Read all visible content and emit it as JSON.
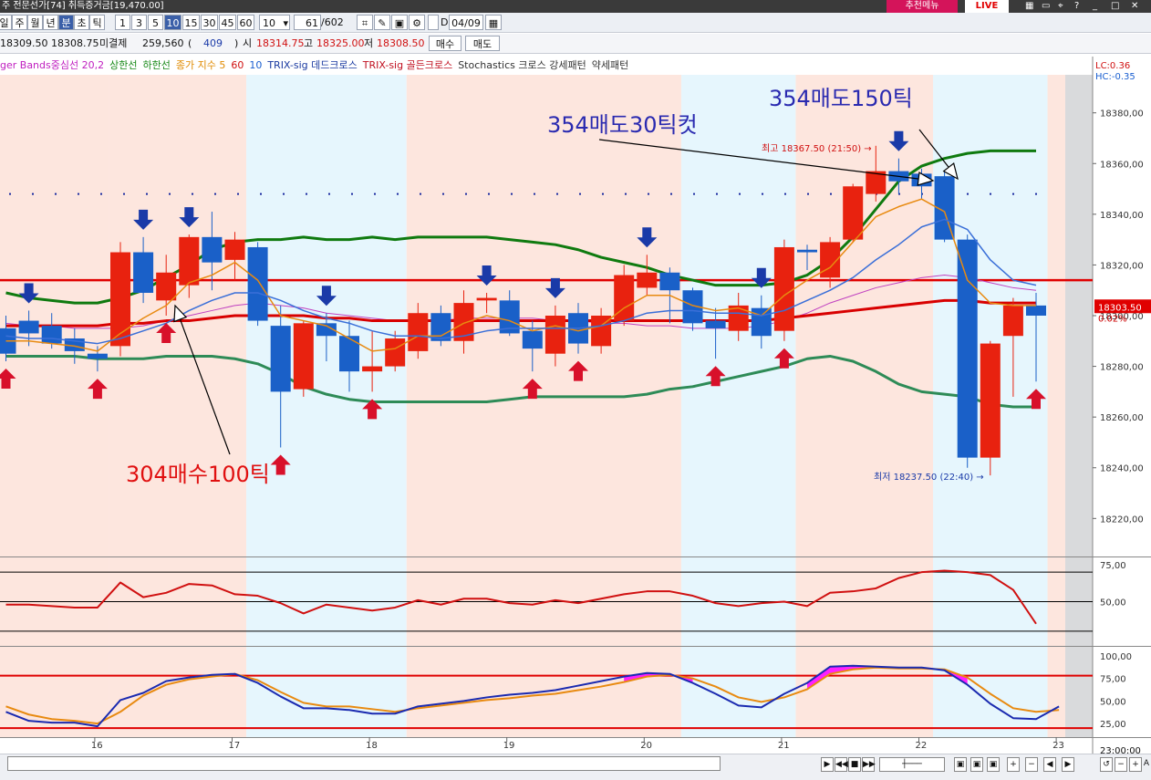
{
  "topbar": {
    "title_fragment": "주 전문선가[74] 취득증거금[19,470.00]",
    "btn_recommend": "추천메뉴",
    "btn_live": "LIVE",
    "icons": [
      "grid-icon",
      "window-icon",
      "pin-icon",
      "help-icon",
      "minimize-icon",
      "maximize-icon",
      "close-icon"
    ]
  },
  "toolbar": {
    "periods": [
      "일",
      "주",
      "월",
      "년",
      "분",
      "초",
      "틱"
    ],
    "selected_period": "분",
    "intervals": [
      "1",
      "3",
      "5",
      "10",
      "15",
      "30",
      "45",
      "60"
    ],
    "selected_interval": "10",
    "interval_input": "10",
    "count_value": "61",
    "count_total": "/602",
    "date_value": "04/09",
    "date_prefix": "D"
  },
  "quote": {
    "current": "18309.50",
    "prev": "18308.75",
    "open_interest_label": "미결제",
    "open_interest": "259,560",
    "paren_open": "(",
    "oi_change": "409",
    "paren_close": ")",
    "open_label": "시",
    "open": "18314.75",
    "high_label": "고",
    "high": "18325.00",
    "low_label": "저",
    "low": "18308.50",
    "buy_label": "매수",
    "sell_label": "매도"
  },
  "legend": [
    {
      "text": "ger Bands중심선 20,2",
      "color": "#c020c0"
    },
    {
      "text": "상한선",
      "color": "#1a8a1a"
    },
    {
      "text": "하한선",
      "color": "#1a8a1a"
    },
    {
      "text": "종가 지수 5",
      "color": "#e08a00"
    },
    {
      "text": "60",
      "color": "#d01010"
    },
    {
      "text": "10",
      "color": "#1a5fd0"
    },
    {
      "text": "TRIX-sig 데드크로스",
      "color": "#1a3aa0"
    },
    {
      "text": "TRIX-sig 골든크로스",
      "color": "#c01020"
    },
    {
      "text": "Stochastics 크로스 강세패턴",
      "color": "#333333"
    },
    {
      "text": "약세패턴",
      "color": "#333333"
    }
  ],
  "right_readout": {
    "lc": "LC:0.36",
    "hc": "HC:-0.35",
    "last_price": "18303.50",
    "last_change": "0.02%"
  },
  "annotations": {
    "buy_note": "304매수100틱",
    "sell_note_1": "354매도150틱",
    "sell_note_2": "354매도30틱컷",
    "high_marker": "최고 18367.50 (21:50) →",
    "low_marker": "최저 18237.50 (22:40) →"
  },
  "bottombar": {
    "time_label": "23:00:00"
  },
  "colors": {
    "up": "#e8220f",
    "down": "#1a60c8",
    "upper_band": "#0f7a0f",
    "lower_band": "#2e8b57",
    "ema5": "#e88a10",
    "ma10": "#3a6fd8",
    "mid_band": "#c040c0",
    "ma60": "#d80000",
    "buy_arrow": "#d8102a",
    "sell_arrow": "#1a3aa8",
    "session_pink": "#fde6de",
    "session_blue": "#e6f6fd"
  },
  "chart_data": {
    "type": "candlestick",
    "price_axis": {
      "ticks": [
        18220,
        18240,
        18260,
        18280,
        18300,
        18320,
        18340,
        18360,
        18380
      ],
      "tick_labels": [
        "18220,00",
        "18240,00",
        "18260,00",
        "18280,00",
        "18300,00",
        "18320,00",
        "18340,00",
        "18360,00",
        "18380,00"
      ],
      "range": [
        18205,
        18395
      ]
    },
    "time_axis": {
      "labels": [
        "16",
        "17",
        "18",
        "19",
        "20",
        "21",
        "22",
        "23"
      ],
      "label_bar_index": [
        4,
        10,
        16,
        22,
        28,
        34,
        40,
        46
      ]
    },
    "sessions": [
      {
        "from": -1,
        "to": 4,
        "shade": "pink"
      },
      {
        "from": 4,
        "to": 10,
        "shade": "pink"
      },
      {
        "from": 10,
        "to": 17,
        "shade": "blue"
      },
      {
        "from": 17,
        "to": 29,
        "shade": "pink"
      },
      {
        "from": 29,
        "to": 34,
        "shade": "blue"
      },
      {
        "from": 34,
        "to": 40,
        "shade": "pink"
      },
      {
        "from": 40,
        "to": 45,
        "shade": "blue"
      },
      {
        "from": 45,
        "to": 47,
        "shade": "pink"
      }
    ],
    "candles": [
      {
        "o": 18295,
        "h": 18300,
        "l": 18282,
        "c": 18285
      },
      {
        "o": 18298,
        "h": 18302,
        "l": 18288,
        "c": 18293
      },
      {
        "o": 18296,
        "h": 18301,
        "l": 18287,
        "c": 18289
      },
      {
        "o": 18291,
        "h": 18295,
        "l": 18281,
        "c": 18286
      },
      {
        "o": 18285,
        "h": 18288,
        "l": 18278,
        "c": 18283
      },
      {
        "o": 18288,
        "h": 18329,
        "l": 18284,
        "c": 18325
      },
      {
        "o": 18325,
        "h": 18331,
        "l": 18305,
        "c": 18309
      },
      {
        "o": 18306,
        "h": 18324,
        "l": 18300,
        "c": 18317
      },
      {
        "o": 18312,
        "h": 18332,
        "l": 18307,
        "c": 18331
      },
      {
        "o": 18331,
        "h": 18341,
        "l": 18310,
        "c": 18321
      },
      {
        "o": 18322,
        "h": 18333,
        "l": 18314,
        "c": 18330
      },
      {
        "o": 18327,
        "h": 18329,
        "l": 18296,
        "c": 18298
      },
      {
        "o": 18296,
        "h": 18304,
        "l": 18248,
        "c": 18270
      },
      {
        "o": 18271,
        "h": 18298,
        "l": 18268,
        "c": 18297
      },
      {
        "o": 18297,
        "h": 18301,
        "l": 18282,
        "c": 18292
      },
      {
        "o": 18292,
        "h": 18298,
        "l": 18270,
        "c": 18278
      },
      {
        "o": 18278,
        "h": 18294,
        "l": 18270,
        "c": 18280
      },
      {
        "o": 18280,
        "h": 18294,
        "l": 18278,
        "c": 18291
      },
      {
        "o": 18286,
        "h": 18305,
        "l": 18283,
        "c": 18301
      },
      {
        "o": 18301,
        "h": 18304,
        "l": 18288,
        "c": 18290
      },
      {
        "o": 18290,
        "h": 18310,
        "l": 18285,
        "c": 18305
      },
      {
        "o": 18306,
        "h": 18309,
        "l": 18301,
        "c": 18307
      },
      {
        "o": 18306,
        "h": 18310,
        "l": 18292,
        "c": 18293
      },
      {
        "o": 18294,
        "h": 18298,
        "l": 18278,
        "c": 18287
      },
      {
        "o": 18285,
        "h": 18304,
        "l": 18280,
        "c": 18300
      },
      {
        "o": 18301,
        "h": 18305,
        "l": 18285,
        "c": 18289
      },
      {
        "o": 18288,
        "h": 18303,
        "l": 18285,
        "c": 18300
      },
      {
        "o": 18298,
        "h": 18320,
        "l": 18296,
        "c": 18316
      },
      {
        "o": 18311,
        "h": 18324,
        "l": 18308,
        "c": 18317
      },
      {
        "o": 18317,
        "h": 18319,
        "l": 18297,
        "c": 18310
      },
      {
        "o": 18310,
        "h": 18311,
        "l": 18294,
        "c": 18297
      },
      {
        "o": 18298,
        "h": 18303,
        "l": 18283,
        "c": 18295
      },
      {
        "o": 18294,
        "h": 18309,
        "l": 18290,
        "c": 18304
      },
      {
        "o": 18303,
        "h": 18308,
        "l": 18287,
        "c": 18292
      },
      {
        "o": 18294,
        "h": 18330,
        "l": 18290,
        "c": 18327
      },
      {
        "o": 18326,
        "h": 18328,
        "l": 18318,
        "c": 18325
      },
      {
        "o": 18315,
        "h": 18331,
        "l": 18311,
        "c": 18329
      },
      {
        "o": 18330,
        "h": 18352,
        "l": 18329,
        "c": 18351
      },
      {
        "o": 18348,
        "h": 18367,
        "l": 18345,
        "c": 18357
      },
      {
        "o": 18357,
        "h": 18362,
        "l": 18348,
        "c": 18353
      },
      {
        "o": 18356,
        "h": 18358,
        "l": 18346,
        "c": 18351
      },
      {
        "o": 18355,
        "h": 18357,
        "l": 18329,
        "c": 18330
      },
      {
        "o": 18330,
        "h": 18332,
        "l": 18240,
        "c": 18244
      },
      {
        "o": 18244,
        "h": 18290,
        "l": 18237,
        "c": 18289
      },
      {
        "o": 18292,
        "h": 18307,
        "l": 18268,
        "c": 18304
      },
      {
        "o": 18304,
        "h": 18309,
        "l": 18274,
        "c": 18300
      }
    ],
    "series": [
      {
        "name": "상한선",
        "values": [
          18309,
          18307,
          18306,
          18305,
          18305,
          18307,
          18310,
          18315,
          18320,
          18326,
          18329,
          18330,
          18330,
          18331,
          18330,
          18330,
          18331,
          18330,
          18331,
          18331,
          18331,
          18331,
          18330,
          18329,
          18328,
          18326,
          18323,
          18321,
          18319,
          18316,
          18314,
          18312,
          18312,
          18312,
          18313,
          18316,
          18322,
          18331,
          18342,
          18353,
          18359,
          18362,
          18364,
          18365,
          18365,
          18365
        ]
      },
      {
        "name": "하한선",
        "values": [
          18284,
          18284,
          18284,
          18284,
          18283,
          18283,
          18283,
          18284,
          18284,
          18284,
          18283,
          18281,
          18277,
          18272,
          18269,
          18267,
          18266,
          18266,
          18266,
          18266,
          18266,
          18266,
          18267,
          18268,
          18268,
          18268,
          18268,
          18268,
          18269,
          18271,
          18272,
          18274,
          18276,
          18278,
          18280,
          18283,
          18284,
          18282,
          18278,
          18273,
          18270,
          18269,
          18268,
          18265,
          18264,
          18264
        ]
      },
      {
        "name": "종가 지수 5",
        "values": [
          18290,
          18290,
          18289,
          18288,
          18286,
          18293,
          18299,
          18304,
          18313,
          18316,
          18321,
          18314,
          18300,
          18298,
          18296,
          18291,
          18286,
          18287,
          18292,
          18292,
          18297,
          18300,
          18298,
          18294,
          18296,
          18294,
          18296,
          18303,
          18308,
          18308,
          18304,
          18302,
          18303,
          18300,
          18308,
          18314,
          18319,
          18329,
          18339,
          18343,
          18346,
          18341,
          18314,
          18305,
          18304,
          18304
        ]
      },
      {
        "name": "10",
        "values": [
          18292,
          18291,
          18291,
          18290,
          18289,
          18291,
          18294,
          18297,
          18302,
          18306,
          18309,
          18309,
          18306,
          18302,
          18299,
          18297,
          18294,
          18292,
          18292,
          18291,
          18292,
          18294,
          18295,
          18295,
          18295,
          18295,
          18296,
          18298,
          18301,
          18302,
          18302,
          18301,
          18301,
          18300,
          18302,
          18306,
          18310,
          18315,
          18322,
          18328,
          18335,
          18338,
          18334,
          18322,
          18314,
          18312
        ]
      },
      {
        "name": "ger Bands중심선 20,2",
        "values": [
          18297,
          18296,
          18296,
          18295,
          18295,
          18295,
          18296,
          18298,
          18300,
          18302,
          18304,
          18305,
          18304,
          18303,
          18301,
          18300,
          18299,
          18298,
          18298,
          18298,
          18299,
          18299,
          18299,
          18299,
          18298,
          18298,
          18297,
          18297,
          18296,
          18296,
          18295,
          18295,
          18295,
          18296,
          18298,
          18301,
          18305,
          18308,
          18311,
          18313,
          18315,
          18316,
          18315,
          18313,
          18311,
          18310
        ]
      },
      {
        "name": "60",
        "values": [
          18296,
          18296,
          18296,
          18296,
          18296,
          18297,
          18297,
          18298,
          18298,
          18299,
          18300,
          18300,
          18300,
          18300,
          18299,
          18299,
          18298,
          18298,
          18298,
          18298,
          18298,
          18298,
          18298,
          18298,
          18298,
          18298,
          18298,
          18298,
          18298,
          18298,
          18298,
          18298,
          18298,
          18298,
          18299,
          18300,
          18301,
          18302,
          18303,
          18304,
          18305,
          18306,
          18306,
          18305,
          18305,
          18305
        ]
      }
    ],
    "resistance_line": 18314,
    "dotted_line": 18348,
    "buy_signals": [
      0,
      4,
      7,
      12,
      16,
      23,
      25,
      31,
      34,
      45
    ],
    "sell_signals": [
      1,
      6,
      8,
      14,
      21,
      24,
      28,
      33,
      39
    ],
    "panel_trix": {
      "ticks": [
        "75,00",
        "50,00"
      ],
      "range": [
        20,
        80
      ],
      "hlines": [
        70,
        50,
        30
      ],
      "series": [
        {
          "name": "TRIX-sig",
          "values": [
            48,
            48,
            47,
            46,
            46,
            63,
            53,
            56,
            62,
            61,
            55,
            54,
            49,
            42,
            48,
            46,
            44,
            46,
            51,
            48,
            52,
            52,
            49,
            48,
            51,
            49,
            52,
            55,
            57,
            57,
            54,
            49,
            47,
            49,
            50,
            47,
            56,
            57,
            59,
            66,
            70,
            71,
            70,
            68,
            58,
            35,
            45,
            46,
            46
          ]
        }
      ]
    },
    "panel_stoch": {
      "ticks": [
        "100,00",
        "75,00",
        "50,00",
        "25,00"
      ],
      "range": [
        10,
        110
      ],
      "hlines": [
        78,
        20
      ],
      "series": [
        {
          "name": "%K",
          "values": [
            38,
            28,
            26,
            26,
            22,
            51,
            59,
            72,
            76,
            79,
            80,
            70,
            55,
            42,
            42,
            40,
            36,
            36,
            44,
            47,
            50,
            54,
            57,
            59,
            62,
            67,
            72,
            77,
            81,
            80,
            70,
            58,
            45,
            43,
            58,
            70,
            88,
            89,
            88,
            87,
            87,
            84,
            68,
            47,
            31,
            30,
            44
          ]
        },
        {
          "name": "%D",
          "values": [
            44,
            35,
            30,
            28,
            25,
            38,
            56,
            68,
            74,
            77,
            80,
            73,
            60,
            48,
            44,
            44,
            41,
            38,
            42,
            45,
            48,
            51,
            53,
            56,
            58,
            62,
            66,
            71,
            77,
            79,
            75,
            66,
            54,
            49,
            54,
            63,
            80,
            85,
            87,
            86,
            86,
            85,
            76,
            58,
            42,
            38,
            40
          ]
        }
      ]
    }
  }
}
